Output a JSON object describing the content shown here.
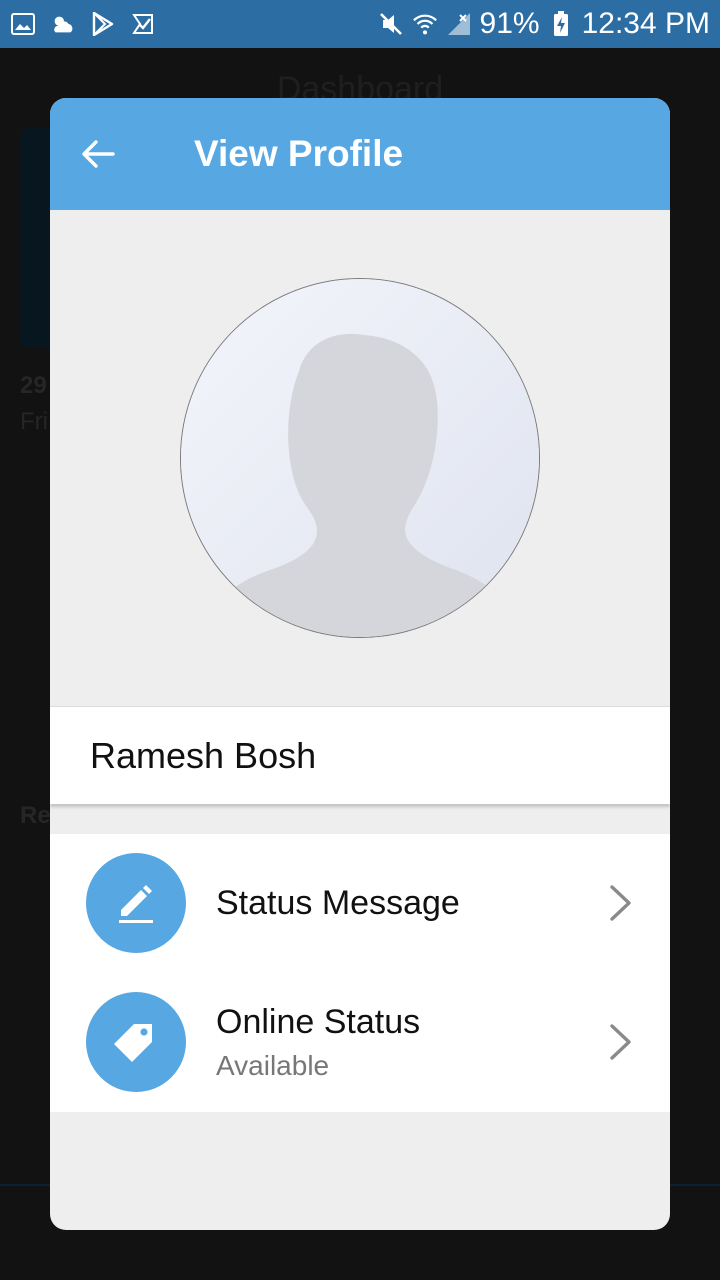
{
  "status_bar": {
    "battery": "91%",
    "time": "12:34 PM",
    "left_icons": [
      "image-icon",
      "weather-icon",
      "play-store-icon",
      "task-icon"
    ],
    "right_icons": [
      "mute-icon",
      "wifi-icon",
      "signal-icon",
      "battery-charging-icon"
    ]
  },
  "background": {
    "title": "Dashboard",
    "snippets": [
      "29",
      "Fri",
      "Re"
    ]
  },
  "dialog": {
    "title": "View Profile",
    "back_icon": "arrow-left-icon",
    "avatar_icon": "default-avatar-silhouette",
    "name": "Ramesh Bosh",
    "items": [
      {
        "label": "Status Message",
        "sublabel": "",
        "icon": "pencil-icon"
      },
      {
        "label": "Online Status",
        "sublabel": "Available",
        "icon": "tag-icon"
      }
    ]
  },
  "colors": {
    "accent": "#57a8e2",
    "status_bar": "#2c6ea3",
    "dialog_bg": "#eeeeee"
  }
}
